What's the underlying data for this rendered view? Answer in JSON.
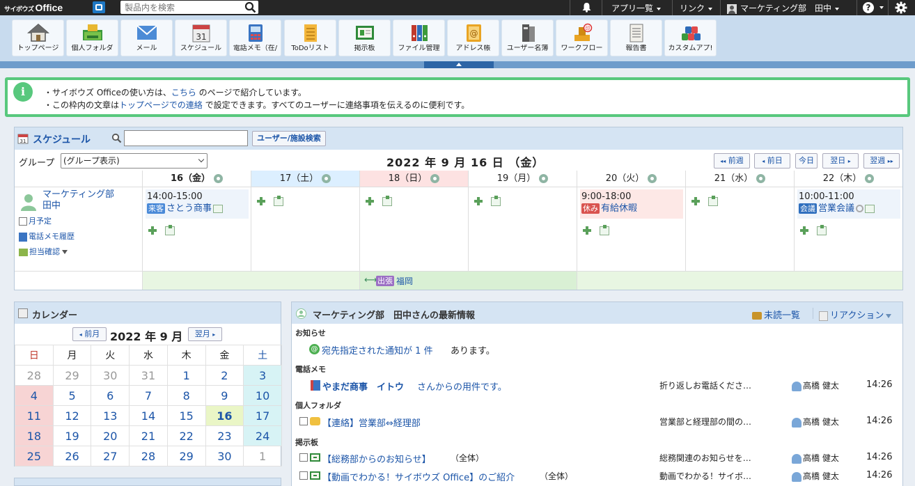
{
  "topbar": {
    "logo_ja": "サイボウズ",
    "logo_en": "Office",
    "search_placeholder": "製品内を検索",
    "app_list": "アプリ一覧",
    "link": "リンク",
    "user": "マーケティング部　田中"
  },
  "apps": [
    {
      "label": "トップページ",
      "icon": "home-icon"
    },
    {
      "label": "個人フォルダ",
      "icon": "folder-icon"
    },
    {
      "label": "メール",
      "icon": "mail-icon"
    },
    {
      "label": "スケジュール",
      "icon": "calendar-icon"
    },
    {
      "label": "電話メモ（在/",
      "icon": "phone-memo-icon"
    },
    {
      "label": "ToDoリスト",
      "icon": "todo-icon"
    },
    {
      "label": "掲示板",
      "icon": "board-icon"
    },
    {
      "label": "ファイル管理",
      "icon": "binder-icon"
    },
    {
      "label": "アドレス帳",
      "icon": "address-book-icon"
    },
    {
      "label": "ユーザー名簿",
      "icon": "roster-icon"
    },
    {
      "label": "ワークフロー",
      "icon": "workflow-icon"
    },
    {
      "label": "報告書",
      "icon": "report-icon"
    },
    {
      "label": "カスタムアプ!",
      "icon": "custom-app-icon"
    }
  ],
  "info": {
    "line1_a": "・サイボウズ Officeの使い方は、",
    "line1_link": "こちら",
    "line1_b": " のページで紹介しています。",
    "line2_a": "・この枠内の文章は",
    "line2_link": "トップページでの連絡",
    "line2_b": " で設定できます。すべてのユーザーに連絡事項を伝えるのに便利です。"
  },
  "schedule": {
    "title": "スケジュール",
    "user_search": "ユーザー/施設検索",
    "group_label": "グループ",
    "group_value": "(グループ表示)",
    "date_title": "2022 年 9 月 16 日 （金）",
    "nav": {
      "prev_week": "前週",
      "prev_day": "前日",
      "today": "今日",
      "next_day": "翌日",
      "next_week": "翌週"
    },
    "days": [
      "16（金）",
      "17（土）",
      "18（日）",
      "19（月）",
      "20（火）",
      "21（水）",
      "22（木）"
    ],
    "user_name": "マーケティング部\n田中",
    "links": [
      "月予定",
      "電話メモ履歴",
      "担当確認"
    ],
    "events": {
      "d0": {
        "time": "14:00-15:00",
        "tag": "来客",
        "title": "さとう商事"
      },
      "d4": {
        "time": "9:00-18:00",
        "tag": "休み",
        "title": "有給休暇"
      },
      "d6": {
        "time": "10:00-11:00",
        "tag": "会議",
        "title": "営業会議"
      }
    },
    "banner": {
      "tag": "出張",
      "title": "福岡"
    },
    "colors": {
      "visitor": "#4a8ad8",
      "holiday": "#d9534f",
      "meeting": "#2f6fbe",
      "trip": "#9b6fc4",
      "banner_bg": "#d9f0d4",
      "sat_bg": "#dcefff",
      "sun_bg": "#fde2e2"
    }
  },
  "calendar": {
    "title": "カレンダー",
    "prev": "前月",
    "month": "2022 年 9 月",
    "next": "翌月",
    "weekdays": [
      "日",
      "月",
      "火",
      "水",
      "木",
      "金",
      "土"
    ],
    "weeks": [
      [
        "28",
        "29",
        "30",
        "31",
        "1",
        "2",
        "3"
      ],
      [
        "4",
        "5",
        "6",
        "7",
        "8",
        "9",
        "10"
      ],
      [
        "11",
        "12",
        "13",
        "14",
        "15",
        "16",
        "17"
      ],
      [
        "18",
        "19",
        "20",
        "21",
        "22",
        "23",
        "24"
      ],
      [
        "25",
        "26",
        "27",
        "28",
        "29",
        "30",
        "1"
      ]
    ],
    "today": "16"
  },
  "news": {
    "title": "マーケティング部　田中さんの最新情報",
    "unread": "未読一覧",
    "reaction": "リアクション",
    "sections": {
      "notice": "お知らせ",
      "phone": "電話メモ",
      "folder": "個人フォルダ",
      "board": "掲示板"
    },
    "notice": {
      "link": "宛先指定された通知が",
      "count": "1",
      "unit": "件",
      "suffix": "あります。"
    },
    "phone_row": {
      "company": "やまだ商事",
      "person": "イトウ",
      "text": "さんからの用件です。",
      "summary": "折り返しお電話くださ…",
      "user": "高橋 健太",
      "time": "14:26"
    },
    "folder_row": {
      "title": "【連絡】営業部⇔経理部",
      "summary": "営業部と経理部の間の…",
      "user": "高橋 健太",
      "time": "14:26"
    },
    "board_rows": [
      {
        "title": "【総務部からのお知らせ】",
        "scope": "（全体）",
        "summary": "総務関連のお知らせを…",
        "user": "高橋 健太",
        "time": "14:26"
      },
      {
        "title": "【動画でわかる！サイボウズ Office】のご紹介",
        "scope": "（全体）",
        "summary": "動画でわかる！サイボ…",
        "user": "高橋 健太",
        "time": "14:26"
      }
    ]
  }
}
